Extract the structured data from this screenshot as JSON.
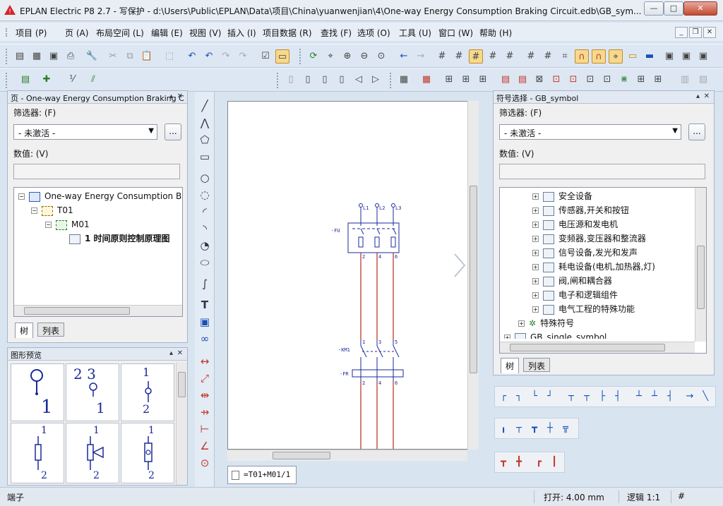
{
  "window": {
    "title": "EPLAN Electric P8 2.7 - 写保护 - d:\\Users\\Public\\EPLAN\\Data\\项目\\China\\yuanwenjian\\4\\One-way Energy Consumption Braking Circuit.edb\\GB_sym...",
    "min": "—",
    "max": "□",
    "close": "✕"
  },
  "menu": [
    "项目 (P)",
    "页 (A)",
    "布局空间 (L)",
    "编辑 (E)",
    "视图 (V)",
    "插入 (I)",
    "项目数据 (R)",
    "查找 (F)",
    "选项 (O)",
    "工具 (U)",
    "窗口 (W)",
    "帮助 (H)"
  ],
  "mdi": {
    "min": "_",
    "restore": "❐",
    "close": "✕"
  },
  "page_panel": {
    "title": "页 - One-way Energy Consumption Braking C",
    "filter_label": "筛选器: (F)",
    "filter_value": "- 未激活 -",
    "dots": "...",
    "value_label": "数值: (V)",
    "tree": {
      "root": "One-way Energy Consumption B",
      "t01": "T01",
      "m01": "M01",
      "page": "1 时间原则控制原理图"
    },
    "tabs": [
      "树",
      "列表"
    ]
  },
  "preview_panel": {
    "title": "图形预览",
    "cells": [
      {
        "a": "",
        "b": "1"
      },
      {
        "a": "2  3",
        "b": "1"
      },
      {
        "a": "1",
        "b": "2"
      },
      {
        "a": "1",
        "b": "2"
      },
      {
        "a": "1",
        "b": "2"
      },
      {
        "a": "1",
        "b": "2"
      }
    ]
  },
  "symbol_panel": {
    "title": "符号选择 - GB_symbol",
    "filter_label": "筛选器: (F)",
    "filter_value": "- 未激活 -",
    "dots": "...",
    "value_label": "数值: (V)",
    "items": [
      "安全设备",
      "传感器,开关和按钮",
      "电压源和发电机",
      "变频器,变压器和整流器",
      "信号设备,发光和发声",
      "耗电设备(电机,加热器,灯)",
      "阀,闸和耦合器",
      "电子和逻辑组件",
      "电气工程的特殊功能",
      "特殊符号",
      "GB_single_symbol"
    ],
    "tabs": [
      "树",
      "列表"
    ]
  },
  "schematic": {
    "phases": [
      "L1",
      "L2",
      "L3"
    ],
    "fu": "-FU",
    "km": "-KM1",
    "fr": "-FR",
    "terms": [
      "1",
      "2",
      "3",
      "4",
      "5",
      "6"
    ],
    "colors": {
      "wire": "#c0392b",
      "line": "#1a2a9c"
    }
  },
  "page_tab": "=T01+M01/1",
  "status": {
    "left": "端子",
    "open": "打开: 4.00 mm",
    "logic": "逻辑 1:1",
    "hash": "#"
  }
}
